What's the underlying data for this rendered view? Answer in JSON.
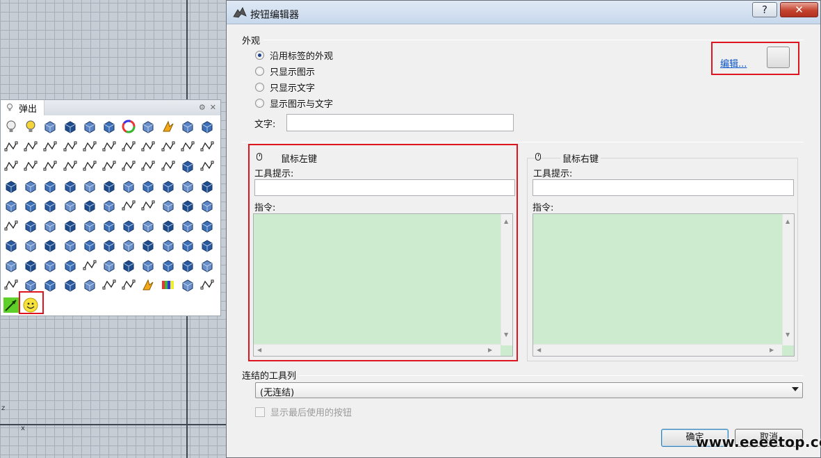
{
  "viewport": {
    "axis_z": "z",
    "axis_x": "x"
  },
  "popup": {
    "tab_label": "弹出",
    "icons": [
      "lightbulb-icon",
      "light-on-icon",
      "lock-icon",
      "zoom-extents-icon",
      "shade-icon",
      "render-sphere-icon",
      "color-wheel-icon",
      "gear-icon",
      "lightning-icon",
      "paint-icon",
      "spheres-icon",
      "polyline-icon",
      "rectangle-dashed-icon",
      "point-rect-icon",
      "point-pair-icon",
      "dotted-line-icon",
      "dashed-line-icon",
      "point-line-icon",
      "curve-points-icon",
      "curve-ctrl-icon",
      "circle-point-icon",
      "arc-icon",
      "rect-icon",
      "rounded-rect-icon",
      "corner-curve-icon",
      "s-curve-icon",
      "triangle-icon",
      "zigzag-icon",
      "number-icon",
      "cylinder-outline-icon",
      "hook-icon",
      "sheet-icon",
      "bracket-icon",
      "surface-icon",
      "surface2-icon",
      "surface3-icon",
      "box-icon",
      "surface4-icon",
      "surface5-icon",
      "surface6-icon",
      "disk-icon",
      "people-icon",
      "people2-icon",
      "mirror-icon",
      "panel-icon",
      "panel2-icon",
      "sphere-icon",
      "twist-icon",
      "node-icon",
      "loading-icon",
      "arc2-icon",
      "arc3-icon",
      "funnel-icon",
      "tool-icon",
      "cut-icon",
      "arch-icon",
      "blob-icon",
      "shell-icon",
      "fold-icon",
      "twist2-icon",
      "plane-icon",
      "bend-icon",
      "pipe-icon",
      "stack-icon",
      "corner-icon",
      "frame-icon",
      "column-icon",
      "cube-icon",
      "cube2-icon",
      "hourglass-icon",
      "split-icon",
      "slab-icon",
      "slant-icon",
      "solid-icon",
      "cylinder-icon",
      "extrude-icon",
      "wedge-icon",
      "mesh-icon",
      "graph-icon",
      "steps-icon",
      "blocks-icon",
      "bracket2-icon",
      "stairs-icon",
      "chain-icon",
      "diamond-icon",
      "slope-icon",
      "curl-icon",
      "vert-icon",
      "arrow-line-icon",
      "tag-icon",
      "flag-icon",
      "sail-icon",
      "cube-tag-icon",
      "dimension-icon",
      "angle-icon",
      "box-gold-icon",
      "color-bars-icon",
      "magnify-icon",
      "sphere-number-icon",
      "green-leaf-icon",
      "smiley-icon"
    ]
  },
  "dialog": {
    "title": "按钮编辑器",
    "help_label": "?",
    "close_label": "✕",
    "appearance": {
      "group_title": "外观",
      "options": [
        "沿用标签的外观",
        "只显示图示",
        "只显示文字",
        "显示图示与文字"
      ],
      "selected_index": 0,
      "edit_link": "编辑...",
      "text_label": "文字:",
      "text_value": ""
    },
    "left_mouse": {
      "title": "鼠标左键",
      "tooltip_label": "工具提示:",
      "tooltip_value": "",
      "command_label": "指令:",
      "command_value": ""
    },
    "right_mouse": {
      "title": "鼠标右键",
      "tooltip_label": "工具提示:",
      "tooltip_value": "",
      "command_label": "指令:",
      "command_value": ""
    },
    "linked_toolbar": {
      "group_title": "连结的工具列",
      "selected": "(无连结)",
      "show_last_used": "显示最后使用的按钮"
    },
    "ok_label": "确定",
    "cancel_label": "取消"
  },
  "watermark": "www.eeeetop.com",
  "colors": {
    "highlight_red": "#e0141e",
    "command_bg": "#cdeccf",
    "link_blue": "#0a55c7"
  }
}
